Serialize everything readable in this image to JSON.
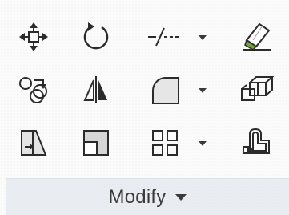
{
  "panel": {
    "title": "Modify",
    "icons": {
      "row1": [
        "move-icon",
        "rotate-icon",
        "trim-extend-icon",
        "erase-icon"
      ],
      "row2": [
        "copy-icon",
        "mirror-icon",
        "fillet-icon",
        "3d-array-icon"
      ],
      "row3": [
        "stretch-icon",
        "scale-icon",
        "array-icon",
        "offset-icon"
      ]
    },
    "colors": {
      "icon": "#2b2b2b",
      "accent_green": "#6fa03a",
      "footer_bg": "#e9edf2"
    }
  }
}
